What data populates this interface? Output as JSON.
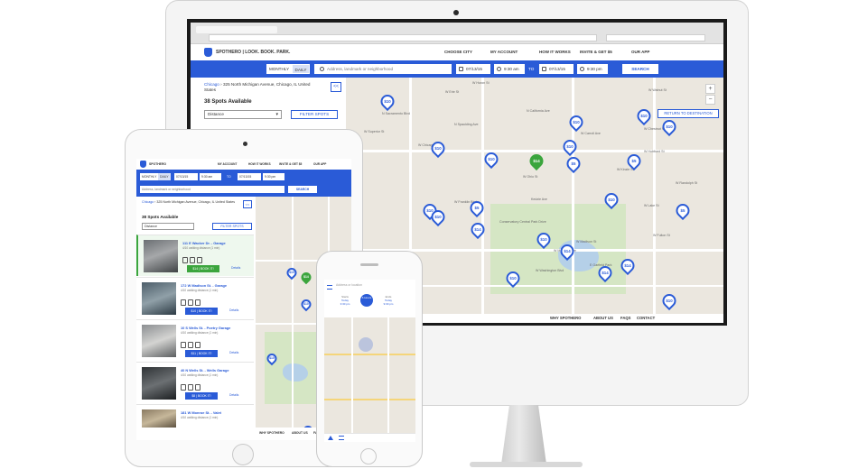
{
  "brand": {
    "name": "SPOTHERO | LOOK. BOOK. PARK.",
    "short_name": "SPOTHERO",
    "accent_color": "#2a5bd7",
    "success_color": "#3ba53d"
  },
  "nav": {
    "choose_city": "CHOOSE CITY",
    "my_account": "MY ACCOUNT",
    "how_it_works": "HOW IT WORKS",
    "invite": "INVITE & GET $5",
    "our_app": "OUR APP"
  },
  "search": {
    "monthly": "MONTHLY",
    "daily": "DAILY",
    "placeholder": "Address, landmark or neighborhood",
    "start_date": "07/13/15",
    "start_time": "9:30 am",
    "to": "TO",
    "end_date": "07/13/15",
    "end_time": "9:30 pm",
    "button": "SEARCH"
  },
  "results": {
    "city": "Chicago",
    "address": "325 North Michigan Avenue, Chicago, IL United States",
    "count": "38 Spots Available",
    "sort": "Distance",
    "filter_button": "FILTER SPOTS",
    "collapse": "<<"
  },
  "map": {
    "return_button": "RETURN TO DESTINATION",
    "zoom_in": "+",
    "zoom_out": "−",
    "streets": [
      "W Chicago Ave",
      "W Ohio St",
      "W Franklin Blvd",
      "W Madison St",
      "W Lake St",
      "W Fulton St",
      "W Randolph St",
      "Kedzie Ave",
      "W Kinzie St",
      "Conservatory Central Park Drive",
      "W Walnut St",
      "W Carroll Ave",
      "W Maypole Ave",
      "W Washington Blvd",
      "E Garfield Park",
      "N Sacramento Blvd",
      "N California Ave",
      "W Chestnut St",
      "W Hubbard St",
      "N Spaulding Ave",
      "W Superior St",
      "W Huron St",
      "W Erie St"
    ],
    "pins": [
      {
        "label": "$10"
      },
      {
        "label": "$10"
      },
      {
        "label": "$10"
      },
      {
        "label": "$14"
      },
      {
        "label": "$10"
      },
      {
        "label": "$10"
      },
      {
        "label": "$10"
      },
      {
        "label": "$5"
      },
      {
        "label": "$10"
      },
      {
        "label": "$5"
      },
      {
        "label": "$10"
      },
      {
        "label": "$5"
      },
      {
        "label": "$14"
      },
      {
        "label": "$14"
      },
      {
        "label": "$14"
      },
      {
        "label": "$10"
      },
      {
        "label": "$10"
      },
      {
        "label": "$14"
      },
      {
        "label": "$10"
      },
      {
        "label": "$5"
      },
      {
        "label": "$10"
      },
      {
        "label": "$10"
      }
    ]
  },
  "footer": {
    "why": "WHY SPOTHERO",
    "about": "ABOUT US",
    "faqs": "FAQS",
    "contact": "CONTACT"
  },
  "listings": [
    {
      "title": "111 E Wacker Dr. - Garage",
      "walk": "4/10 walking distance (1 min)",
      "price": "$14",
      "book": "BOOK IT!",
      "details": "Details"
    },
    {
      "title": "172 W Madison St. - Garage",
      "walk": "4/10 walking distance (1 min)",
      "price": "$10",
      "book": "BOOK IT!",
      "details": "Details"
    },
    {
      "title": "10 S Wells St. - Poetry Garage",
      "walk": "4/10 walking distance (1 min)",
      "price": "$11",
      "book": "BOOK IT!",
      "details": "Details"
    },
    {
      "title": "40 N Wells St. - Wells Garage",
      "walk": "4/10 walking distance (1 min)",
      "price": "$8",
      "book": "BOOK IT!",
      "details": "Details"
    },
    {
      "title": "181 W Monroe St. - Valet",
      "walk": "4/10 walking distance (1 min)",
      "price": "",
      "book": "",
      "details": ""
    }
  ],
  "phone": {
    "address_placeholder": "Address or location",
    "start_label": "Starts",
    "start_day": "Today",
    "start_time": "3:30 pm",
    "hours": "6 Hours",
    "end_label": "Ends",
    "end_day": "Today",
    "end_time": "9:30 pm"
  }
}
